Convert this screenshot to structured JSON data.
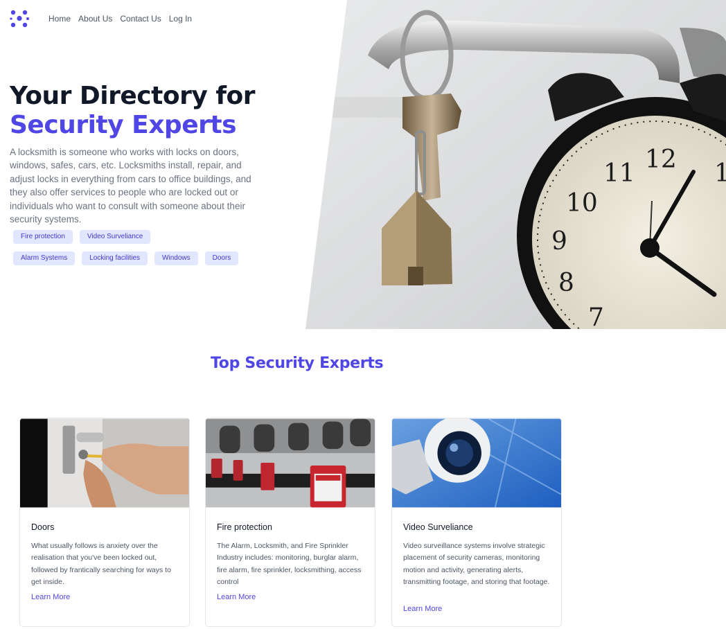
{
  "nav": {
    "logo_icon": "dots-cluster-logo",
    "links": [
      "Home",
      "About Us",
      "Contact Us",
      "Log In"
    ]
  },
  "hero": {
    "title_line1": "Your Directory for",
    "title_line2": "Security Experts",
    "description": "A locksmith is someone who works with locks on doors, windows, safes, cars, etc. Locksmiths install, repair, and adjust locks in everything from cars to office buildings, and they also offer services to people who are locked out or individuals who want to consult with someone about their security systems.",
    "tags": [
      "Fire protection",
      "Video Surveliance",
      "Alarm Systems",
      "Locking facilities",
      "Windows",
      "Doors"
    ],
    "image": "padlock-key-and-alarm-clock-photo"
  },
  "section": {
    "title": "Top Security Experts"
  },
  "cards": [
    {
      "title": "Doors",
      "description": "What usually follows is anxiety over the realisation that you've been locked out, followed by frantically searching for ways to get inside.",
      "link": "Learn More",
      "image": "hands-fixing-door-lock-photo"
    },
    {
      "title": "Fire protection",
      "description": "The Alarm, Locksmith, and Fire Sprinkler Industry includes: monitoring, burglar alarm, fire alarm, fire sprinkler, locksmithing, access control",
      "link": "Learn More",
      "image": "lockout-padlocks-photo"
    },
    {
      "title": "Video Surveliance",
      "description": "Video surveillance systems involve strategic placement of security cameras, monitoring motion and activity, generating alerts, transmitting footage, and storing that footage.",
      "link": "Learn More",
      "image": "security-camera-photo"
    }
  ],
  "colors": {
    "accent": "#4f46e5",
    "tag_bg": "#e0e7ff",
    "text_dark": "#111827",
    "text_muted": "#6b7280"
  }
}
